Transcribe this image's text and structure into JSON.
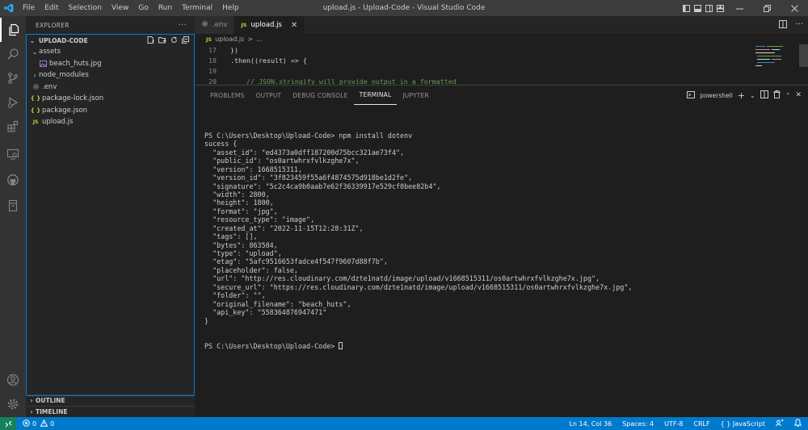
{
  "window": {
    "title": "upload.js - Upload-Code - Visual Studio Code",
    "menu": [
      "File",
      "Edit",
      "Selection",
      "View",
      "Go",
      "Run",
      "Terminal",
      "Help"
    ]
  },
  "sidebar": {
    "header": "EXPLORER",
    "more": "···",
    "folder": "UPLOAD-CODE",
    "tree": [
      {
        "label": "assets",
        "type": "folder-open",
        "indent": 1
      },
      {
        "label": "beach_huts.jpg",
        "type": "image",
        "indent": 2
      },
      {
        "label": "node_modules",
        "type": "folder-closed",
        "indent": 1
      },
      {
        "label": ".env",
        "type": "env",
        "indent": 1
      },
      {
        "label": "package-lock.json",
        "type": "json",
        "indent": 1
      },
      {
        "label": "package.json",
        "type": "json",
        "indent": 1
      },
      {
        "label": "upload.js",
        "type": "js",
        "indent": 1
      }
    ],
    "outline": "OUTLINE",
    "timeline": "TIMELINE"
  },
  "tabs": [
    {
      "label": ".env",
      "icon": "gear-icon",
      "active": false
    },
    {
      "label": "upload.js",
      "icon": "JS",
      "active": true
    }
  ],
  "breadcrumb": {
    "icon": "JS",
    "file": "upload.js",
    "sep": ">",
    "rest": "..."
  },
  "editor": {
    "lines": [
      {
        "num": "17",
        "text": "})"
      },
      {
        "num": "18",
        "text": ".then((result) => {"
      },
      {
        "num": "19",
        "text": ""
      },
      {
        "num": "20",
        "text": "    // JSON.stringify will provide output in a formatted"
      }
    ]
  },
  "panel": {
    "tabs": [
      "PROBLEMS",
      "OUTPUT",
      "DEBUG CONSOLE",
      "TERMINAL",
      "JUPYTER"
    ],
    "active_tab": "TERMINAL",
    "shell": "powershell",
    "terminal_lines": [
      "PS C:\\Users\\Desktop\\Upload-Code> npm install dotenv",
      "sucess {",
      "  \"asset_id\": \"ed4373a0dff187200d75bcc321ae73f4\",",
      "  \"public_id\": \"os0artwhrxfvlkzghe7x\",",
      "  \"version\": 1668515311,",
      "  \"version_id\": \"3f823459f55a6f4874575d918be1d2fe\",",
      "  \"signature\": \"5c2c4ca9b0aab7e62f36339917e529cf0bee82b4\",",
      "  \"width\": 2800,",
      "  \"height\": 1800,",
      "  \"format\": \"jpg\",",
      "  \"resource_type\": \"image\",",
      "  \"created_at\": \"2022-11-15T12:28:31Z\",",
      "  \"tags\": [],",
      "  \"bytes\": 863584,",
      "  \"type\": \"upload\",",
      "  \"etag\": \"5afc9516653fadce4f547f9607d88f7b\",",
      "  \"placeholder\": false,",
      "  \"url\": \"http://res.cloudinary.com/dzte1natd/image/upload/v1668515311/os0artwhrxfvlkzghe7x.jpg\",",
      "  \"secure_url\": \"https://res.cloudinary.com/dzte1natd/image/upload/v1668515311/os0artwhrxfvlkzghe7x.jpg\",",
      "  \"folder\": \"\",",
      "  \"original_filename\": \"beach_huts\",",
      "  \"api_key\": \"558364876947471\"",
      "}"
    ],
    "prompt": "PS C:\\Users\\Desktop\\Upload-Code> "
  },
  "status": {
    "errors": "0",
    "warnings": "0",
    "position": "Ln 14, Col 36",
    "spaces": "Spaces: 4",
    "encoding": "UTF-8",
    "eol": "CRLF",
    "language": "JavaScript",
    "language_braces": "{ }"
  },
  "colors": {
    "accent": "#007acc",
    "remote": "#16825d",
    "js_yellow": "#cbcb41",
    "json_yellow": "#cbcb41",
    "image_purple": "#a074c4"
  }
}
